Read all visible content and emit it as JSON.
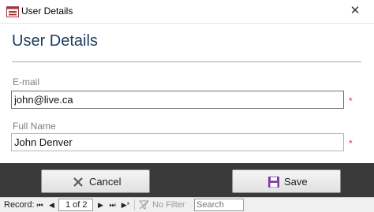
{
  "window": {
    "title": "User Details",
    "close_glyph": "✕",
    "app_icon": "form-icon"
  },
  "form": {
    "heading": "User Details",
    "email": {
      "label": "E-mail",
      "value": "john@live.ca",
      "required_mark": "*"
    },
    "full_name": {
      "label": "Full Name",
      "value": "John Denver",
      "required_mark": "*"
    }
  },
  "buttons": {
    "cancel_label": "Cancel",
    "cancel_icon": "close-x-icon",
    "save_label": "Save",
    "save_icon": "floppy-disk-icon"
  },
  "record_nav": {
    "record_label": "Record:",
    "first_glyph": "⏮",
    "prev_glyph": "◀",
    "current": "1 of 2",
    "next_glyph": "▶",
    "last_glyph": "⏭",
    "new_glyph": "▶*",
    "filter_label": "No Filter",
    "search_placeholder": "Search"
  },
  "colors": {
    "heading": "#1f3b5f",
    "required": "#d83b3b",
    "band": "#3a3a3a",
    "save_icon": "#7b3fa0"
  }
}
